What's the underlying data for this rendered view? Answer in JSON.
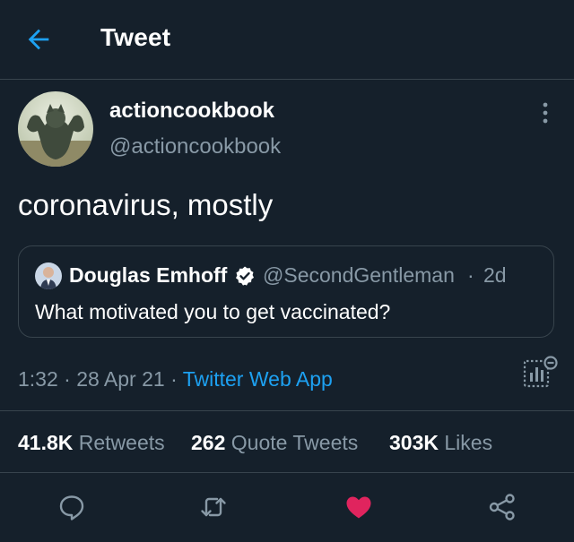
{
  "header": {
    "title": "Tweet",
    "back_icon": "arrow-left-icon"
  },
  "tweet": {
    "display_name": "actioncookbook",
    "handle": "@actioncookbook",
    "text": "coronavirus, mostly",
    "time": "1:32",
    "date": "28 Apr 21",
    "source": "Twitter Web App"
  },
  "quote": {
    "display_name": "Douglas Emhoff",
    "verified": true,
    "handle": "@SecondGentleman",
    "separator": "·",
    "time_ago": "2d",
    "text": "What motivated you to get vaccinated?"
  },
  "meta_separator": "·",
  "stats": {
    "retweets": {
      "count": "41.8K",
      "label": "Retweets"
    },
    "quotes": {
      "count": "262",
      "label": "Quote Tweets"
    },
    "likes": {
      "count": "303K",
      "label": "Likes"
    }
  },
  "actions": [
    "reply-icon",
    "retweet-icon",
    "like-icon",
    "share-icon"
  ],
  "colors": {
    "background": "#15202b",
    "accent": "#1da1f2",
    "muted": "#8899a6",
    "border": "#38444d",
    "like": "#e0245e"
  }
}
